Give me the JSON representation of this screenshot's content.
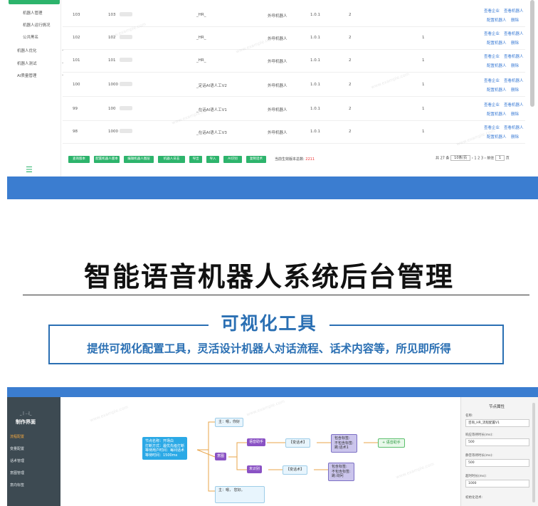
{
  "top_screen": {
    "sidebar": {
      "items": [
        {
          "label": "机器人管理",
          "chevron": ""
        },
        {
          "label": "机器人运行情况",
          "chevron": ""
        },
        {
          "label": "公共黑名",
          "chevron": ""
        },
        {
          "label": "机器人优化",
          "chevron": "⌄"
        },
        {
          "label": "机器人测试",
          "chevron": "⌄"
        },
        {
          "label": "AI质量管理",
          "chevron": "⌄"
        }
      ],
      "menu_icon": "hamburger-icon"
    },
    "table": {
      "rows": [
        {
          "id": "103",
          "code": "103",
          "name": "_HR_",
          "type": "外呼机器人",
          "version": "1.0.1",
          "count": "2",
          "extra": "",
          "act1": "查看企业",
          "act2": "查看机器人",
          "act3": "配置机器人",
          "act4": "删除"
        },
        {
          "id": "102",
          "code": "102",
          "name": "_HR_",
          "type": "外呼机器人",
          "version": "1.0.1",
          "count": "2",
          "extra": "1",
          "act1": "查看企业",
          "act2": "查看机器人",
          "act3": "配置机器人",
          "act4": "删除"
        },
        {
          "id": "101",
          "code": "101",
          "name": "_HR_",
          "type": "外呼机器人",
          "version": "1.0.1",
          "count": "2",
          "extra": "1",
          "act1": "查看企业",
          "act2": "查看机器人",
          "act3": "配置机器人",
          "act4": "删除"
        },
        {
          "id": "100",
          "code": "1000",
          "name": "_定话AI语人工V2",
          "type": "外呼机器人",
          "version": "1.0.1",
          "count": "2",
          "extra": "1",
          "act1": "查看企业",
          "act2": "查看机器人",
          "act3": "配置机器人",
          "act4": "删除"
        },
        {
          "id": "99",
          "code": "100",
          "name": "_在话AI语人工V1",
          "type": "外呼机器人",
          "version": "1.0.1",
          "count": "2",
          "extra": "1",
          "act1": "查看企业",
          "act2": "查看机器人",
          "act3": "配置机器人",
          "act4": "删除"
        },
        {
          "id": "98",
          "code": "1000",
          "name": "_在话AI语人工V3",
          "type": "外呼机器人",
          "version": "1.0.1",
          "count": "2",
          "extra": "1",
          "act1": "查看企业",
          "act2": "查看机器人",
          "act3": "配置机器人",
          "act4": "删除"
        }
      ]
    },
    "buttons": [
      "查询版本",
      "配置机器人版本",
      "编辑机器人图层",
      "机器人日志",
      "导出",
      "导入",
      "AI识别",
      "复制话术"
    ],
    "total_label": "当前生效版本总数:",
    "total_value": "2211",
    "pager": {
      "total": "共 27 条",
      "size": "10条/页",
      "pages": "‹ 1 2 3 ›",
      "goto": "前往",
      "page": "1",
      "unit": "页"
    },
    "watermark": "www.example.com"
  },
  "headline": {
    "main": "智能语音机器人系统后台管理",
    "sub": "可视化工具",
    "desc": "提供可视化配置工具，灵活设计机器人对话流程、话术内容等，所见即所得"
  },
  "bottom_screen": {
    "sidebar": {
      "small": "_ | ...|_",
      "header": "制作界面",
      "items": [
        {
          "label": "流程配置",
          "active": true
        },
        {
          "label": "变量配置",
          "active": false
        },
        {
          "label": "话术管理",
          "active": false
        },
        {
          "label": "意图管理",
          "active": false
        },
        {
          "label": "意向标签",
          "active": false
        }
      ]
    },
    "canvas": {
      "start_node": [
        "节点名称：开场白",
        "打断方式：最优先级打断",
        "等待用户时间：每间话术",
        "等待时间：1500ms"
      ],
      "greeting": "主：嗯，你好",
      "intent_node": "意图",
      "branch_a": "语音助手",
      "branch_b": "未识别",
      "script_a": "【变话术】",
      "script_b": "【变话术】",
      "lav_a": [
        "包含标签:",
        "不包含标签:",
        "跳:话术1"
      ],
      "lav_b": [
        "包含标签:",
        "不包含标签:",
        "跳:询问"
      ],
      "end_node": "+ 语音助手",
      "reply": "主：嗯，         您好。"
    },
    "panel": {
      "title": "节点属性",
      "fields": [
        {
          "label": "名称:",
          "value": "咨询_HR_流程配置V1"
        },
        {
          "label": "响应等待时长(ms):",
          "value": "500"
        },
        {
          "label": "静音等待时长(ms):",
          "value": "500"
        },
        {
          "label": "超时时长(ms):",
          "value": "1000"
        }
      ],
      "last_label": "初始化话术:"
    }
  }
}
